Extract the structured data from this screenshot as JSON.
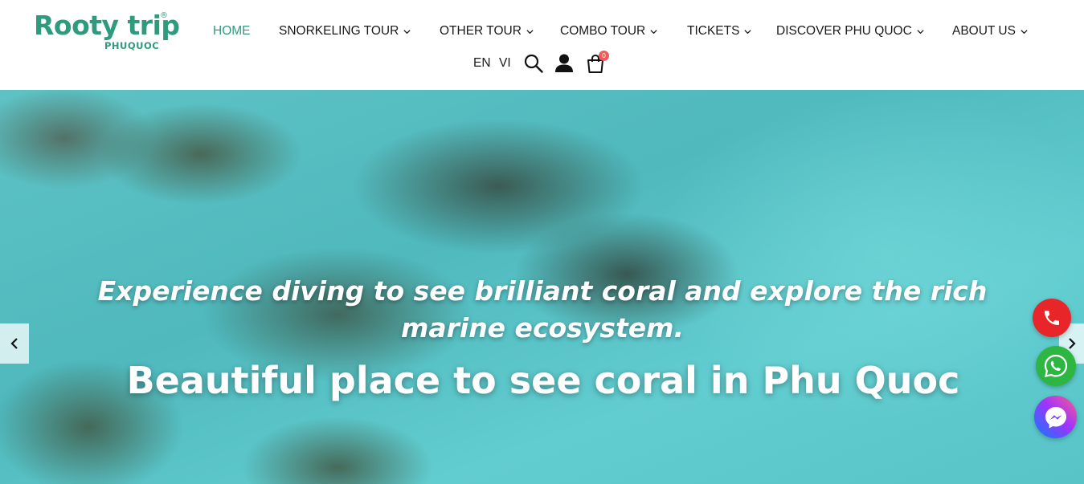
{
  "brand": {
    "name": "Rooty trip",
    "registered": "®",
    "sub": "PHUQUOC",
    "color": "#2e9a7e"
  },
  "nav": {
    "items": [
      {
        "label": "HOME",
        "active": true,
        "dropdown": false
      },
      {
        "label": "SNORKELING TOUR",
        "active": false,
        "dropdown": true
      },
      {
        "label": "OTHER TOUR",
        "active": false,
        "dropdown": true
      },
      {
        "label": "COMBO TOUR",
        "active": false,
        "dropdown": true
      },
      {
        "label": "TICKETS",
        "active": false,
        "dropdown": true
      },
      {
        "label": "DISCOVER PHU QUOC",
        "active": false,
        "dropdown": true
      },
      {
        "label": "ABOUT US",
        "active": false,
        "dropdown": true
      }
    ],
    "active_color": "#2e9a7e"
  },
  "utility": {
    "lang_en": "EN",
    "lang_vi": "VI",
    "cart_count": "0",
    "icons": [
      "search-icon",
      "user-icon",
      "cart-icon"
    ],
    "badge_color": "#f05a5a"
  },
  "hero": {
    "caption": "Experience diving to see brilliant coral and explore the rich marine ecosystem.",
    "title": "Beautiful place to see coral in Phu Quoc"
  },
  "contact": {
    "icons": [
      "phone-icon",
      "whatsapp-icon",
      "messenger-icon"
    ],
    "phone_color": "#e8262a",
    "whatsapp_color": "#2db742"
  }
}
